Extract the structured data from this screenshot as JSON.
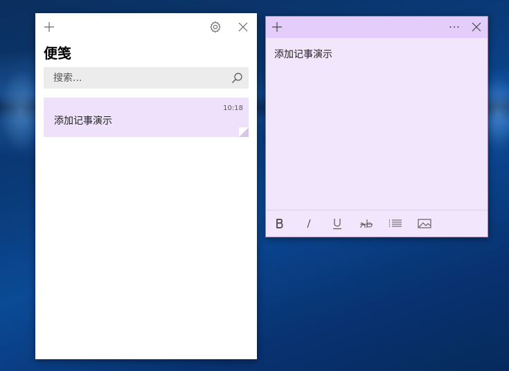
{
  "list_window": {
    "title": "便笺",
    "search": {
      "placeholder": "搜索..."
    },
    "notes": [
      {
        "time": "10:18",
        "text": "添加记事演示"
      }
    ]
  },
  "note_window": {
    "content": "添加记事演示",
    "toolbar": {
      "bold_icon": "bold-icon",
      "italic_icon": "italic-icon",
      "underline_icon": "underline-icon",
      "strikethrough_icon": "strikethrough-icon",
      "bullets_icon": "bullet-list-icon",
      "image_icon": "image-icon"
    }
  },
  "colors": {
    "note_bg": "#f2e6fd",
    "note_header": "#e4cdfa",
    "note_card": "#efe1fb"
  }
}
